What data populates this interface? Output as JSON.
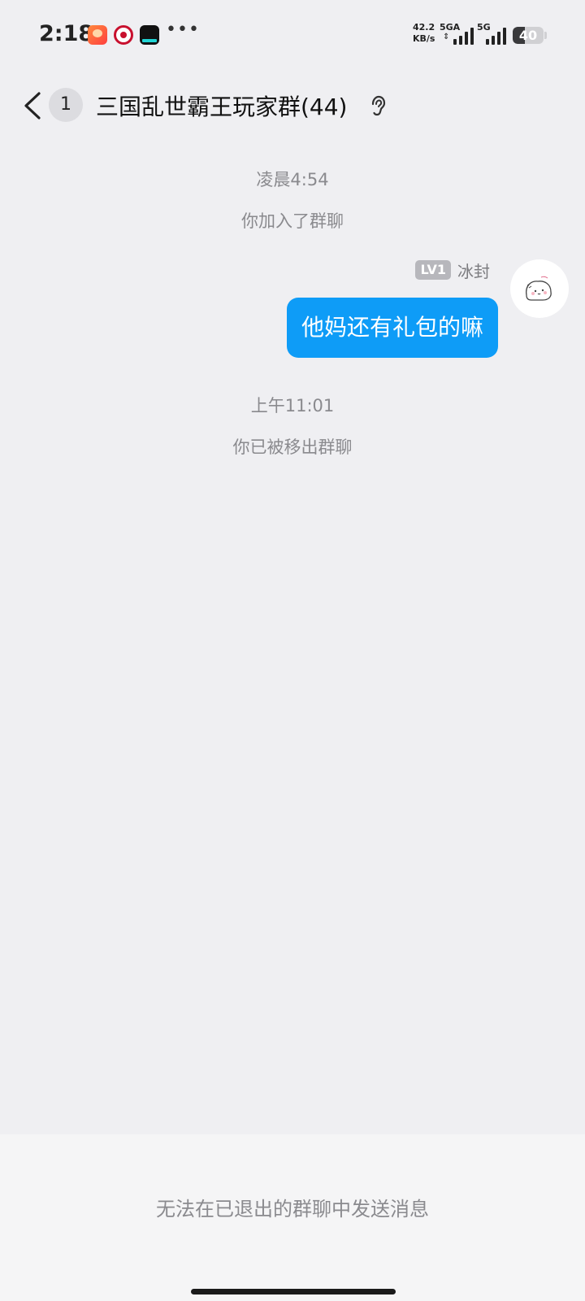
{
  "status_bar": {
    "time": "2:18",
    "more": "•••",
    "net_speed_value": "42.2",
    "net_speed_unit": "KB/s",
    "signal1_label": "5GA",
    "signal2_label": "5G",
    "battery_level": "40",
    "battery_fraction": 0.4
  },
  "header": {
    "unread_count": "1",
    "title": "三国乱世霸王玩家群(44)"
  },
  "messages": {
    "time1": "凌晨4:54",
    "system1": "你加入了群聊",
    "sender_level": "LV1",
    "sender_name": "冰封",
    "bubble_text": "他妈还有礼包的嘛",
    "time2": "上午11:01",
    "system2": "你已被移出群聊"
  },
  "bottom": {
    "notice": "无法在已退出的群聊中发送消息"
  },
  "colors": {
    "background": "#efeff2",
    "bubble": "#0e9cf7",
    "muted_text": "#8a8a8e"
  },
  "icons": [
    "back-arrow-icon",
    "ear-icon",
    "signal-icon",
    "battery-icon",
    "avatar"
  ]
}
